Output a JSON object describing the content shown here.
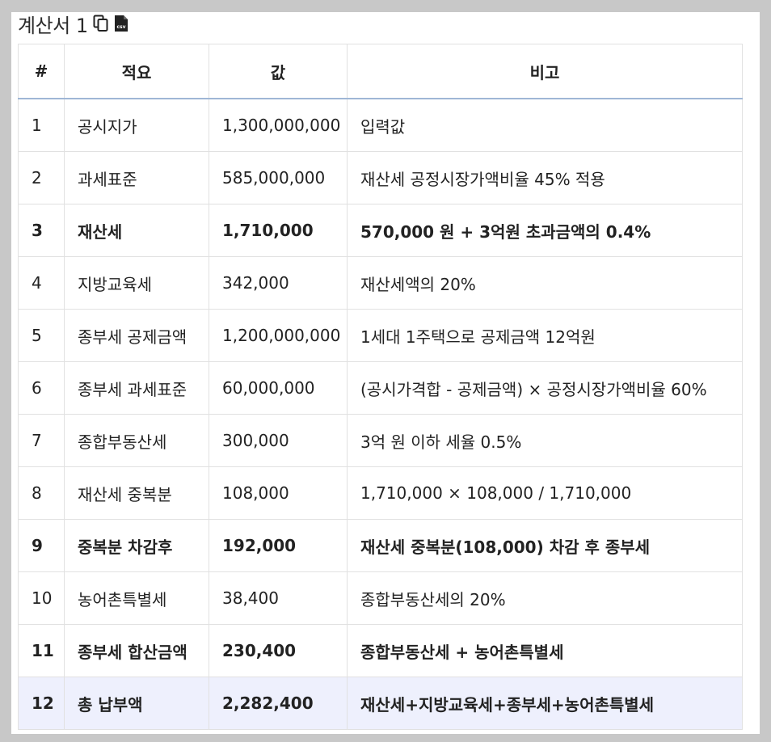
{
  "header": {
    "title": "계산서 1",
    "copy_icon": "copy-icon",
    "csv_icon": "csv-download-icon",
    "csv_icon_text": "csv"
  },
  "table": {
    "columns": [
      "#",
      "적요",
      "값",
      "비고"
    ],
    "rows": [
      {
        "no": "1",
        "item": "공시지가",
        "value": "1,300,000,000",
        "note": "입력값",
        "bold": false
      },
      {
        "no": "2",
        "item": "과세표준",
        "value": "585,000,000",
        "note": "재산세 공정시장가액비율 45% 적용",
        "bold": false
      },
      {
        "no": "3",
        "item": "재산세",
        "value": "1,710,000",
        "note": "570,000 원 + 3억원 초과금액의 0.4%",
        "bold": true
      },
      {
        "no": "4",
        "item": "지방교육세",
        "value": "342,000",
        "note": "재산세액의 20%",
        "bold": false
      },
      {
        "no": "5",
        "item": "종부세 공제금액",
        "value": "1,200,000,000",
        "note": "1세대 1주택으로 공제금액 12억원",
        "bold": false
      },
      {
        "no": "6",
        "item": "종부세 과세표준",
        "value": "60,000,000",
        "note": "(공시가격합 - 공제금액) × 공정시장가액비율 60%",
        "bold": false
      },
      {
        "no": "7",
        "item": "종합부동산세",
        "value": "300,000",
        "note": "3억 원 이하 세율 0.5%",
        "bold": false
      },
      {
        "no": "8",
        "item": "재산세 중복분",
        "value": "108,000",
        "note": "1,710,000 × 108,000 / 1,710,000",
        "bold": false
      },
      {
        "no": "9",
        "item": "중복분 차감후",
        "value": "192,000",
        "note": "재산세 중복분(108,000) 차감 후 종부세",
        "bold": true
      },
      {
        "no": "10",
        "item": "농어촌특별세",
        "value": "38,400",
        "note": "종합부동산세의 20%",
        "bold": false
      },
      {
        "no": "11",
        "item": "종부세 합산금액",
        "value": "230,400",
        "note": "종합부동산세 + 농어촌특별세",
        "bold": true
      },
      {
        "no": "12",
        "item": "총 납부액",
        "value": "2,282,400",
        "note": "재산세+지방교육세+종부세+농어촌특별세",
        "bold": true,
        "highlight": true
      }
    ]
  },
  "colors": {
    "header_border": "#9fb6d6",
    "total_row_bg": "#eef0fd",
    "backdrop": "#c8c8c8"
  }
}
